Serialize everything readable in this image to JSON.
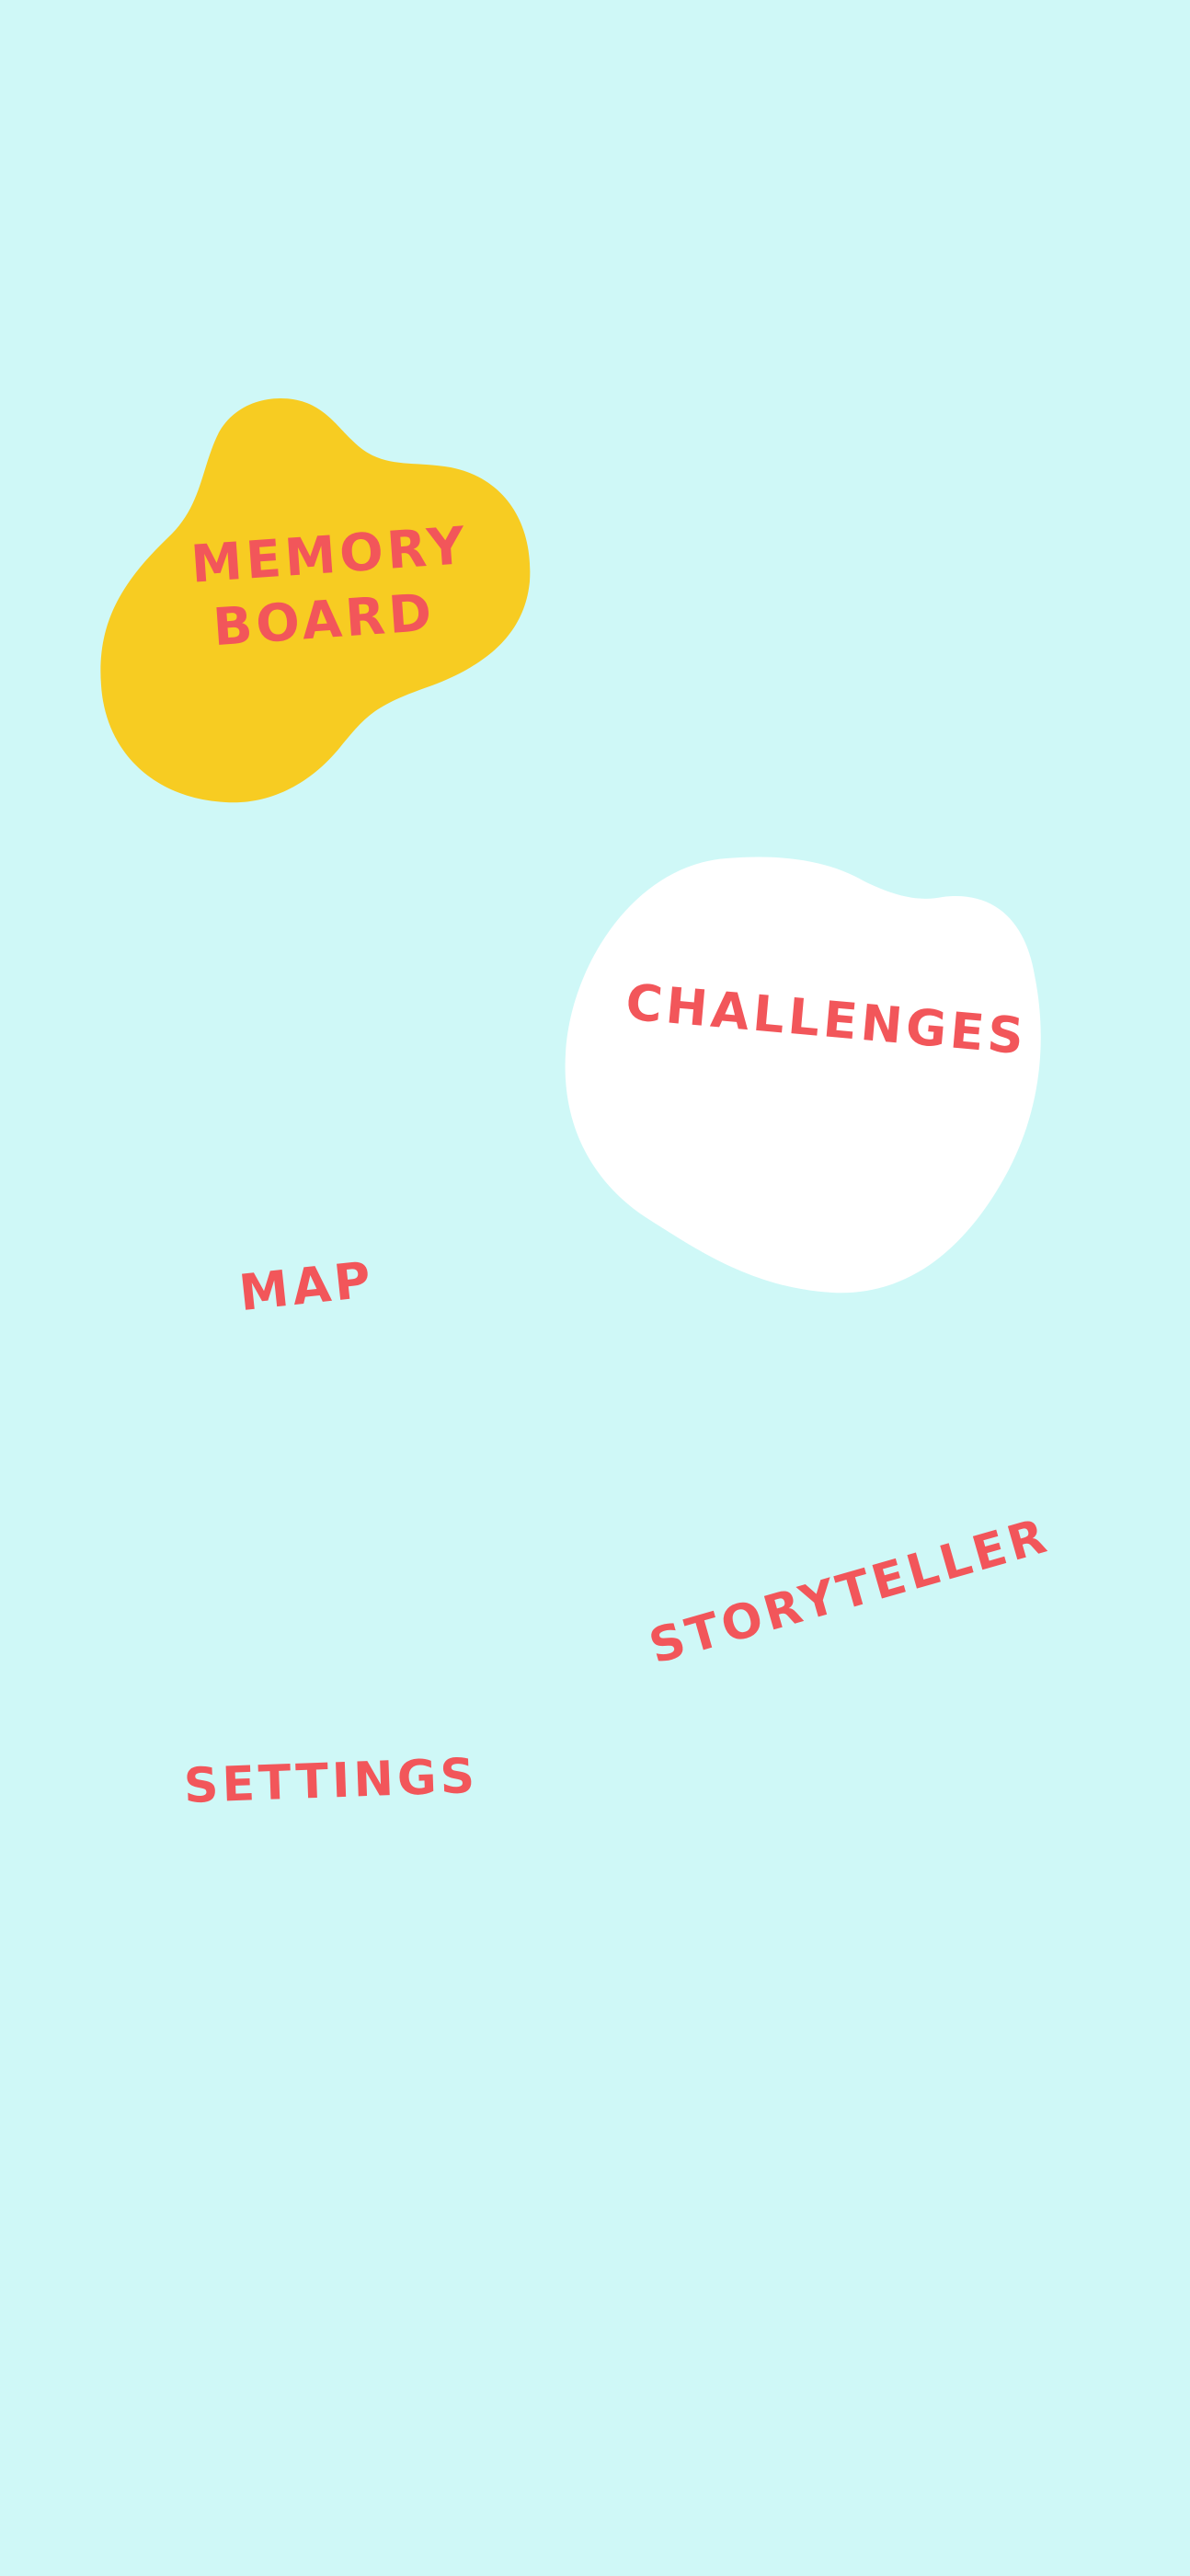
{
  "screen": {
    "background_color": "#cff8f7",
    "label_color": "#f2565a"
  },
  "menu": {
    "memory_board": {
      "line1": "MEMORY",
      "line2": "BOARD",
      "blob_color": "#f7cc22"
    },
    "challenges": {
      "label": "CHALLENGES",
      "blob_color": "#ffffff"
    },
    "map": {
      "label": "MAP"
    },
    "storyteller": {
      "label": "STORYTELLER"
    },
    "settings": {
      "label": "SETTINGS"
    }
  }
}
